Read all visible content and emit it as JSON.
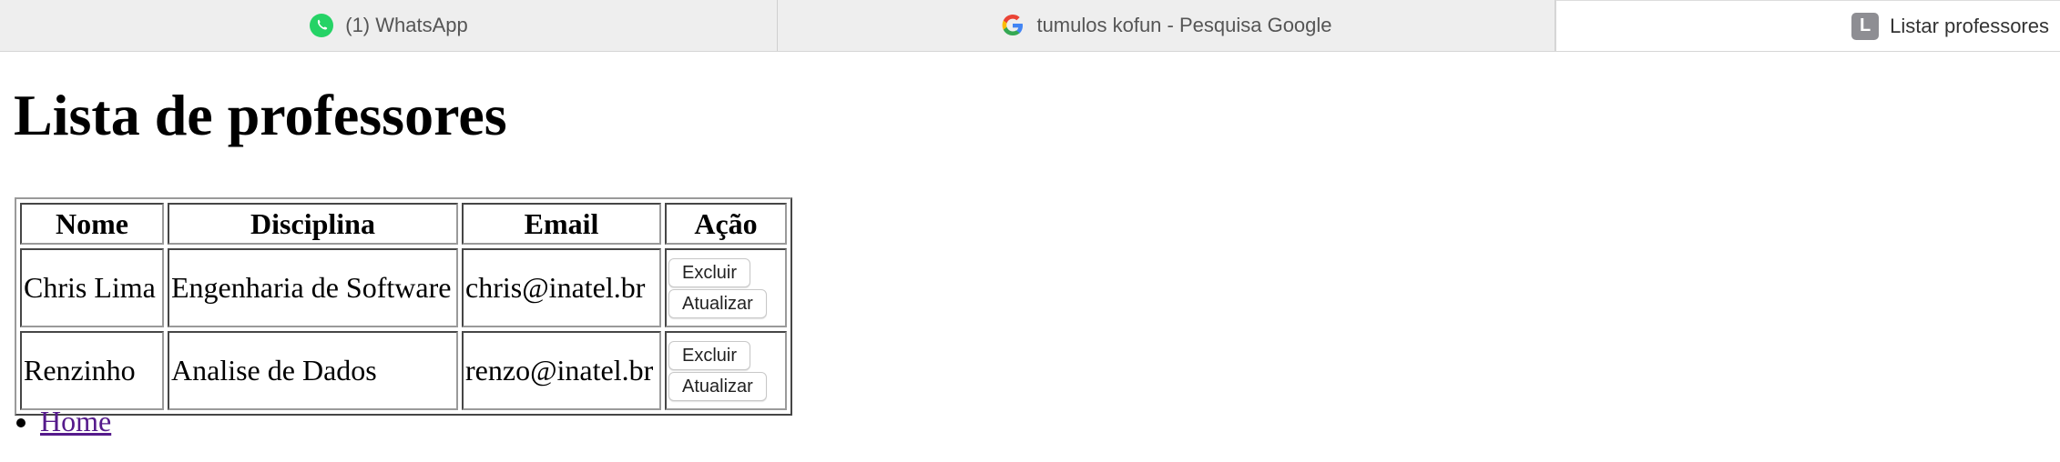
{
  "tabs": [
    {
      "label": "(1) WhatsApp",
      "icon": "whatsapp-icon",
      "color": "#25d366"
    },
    {
      "label": "tumulos kofun - Pesquisa Google",
      "icon": "google-icon"
    },
    {
      "label": "Listar professores",
      "icon_letter": "L",
      "active": true
    }
  ],
  "page": {
    "heading": "Lista de professores",
    "table": {
      "headers": [
        "Nome",
        "Disciplina",
        "Email",
        "Ação"
      ],
      "rows": [
        {
          "nome": "Chris Lima",
          "disciplina": "Engenharia de Software",
          "email": "chris@inatel.br",
          "delete_label": "Excluir",
          "update_label": "Atualizar"
        },
        {
          "nome": "Renzinho",
          "disciplina": "Analise de Dados",
          "email": "renzo@inatel.br",
          "delete_label": "Excluir",
          "update_label": "Atualizar"
        }
      ]
    },
    "links": [
      {
        "label": "Home"
      }
    ]
  }
}
